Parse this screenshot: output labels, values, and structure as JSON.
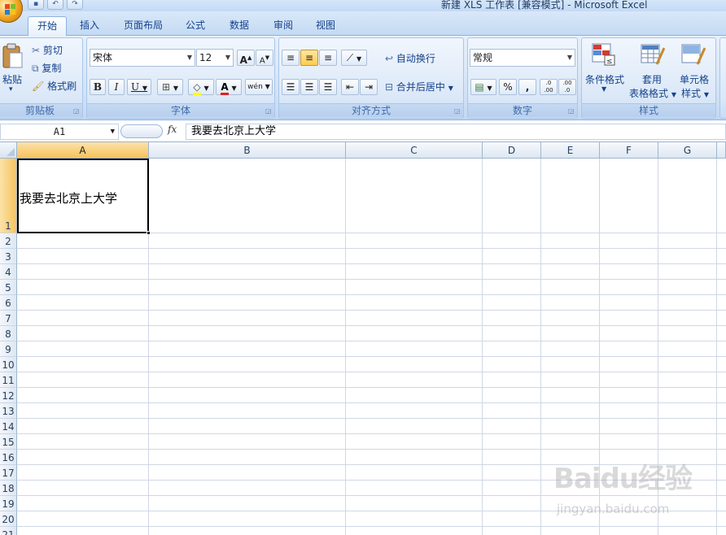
{
  "window": {
    "title": "新建 XLS 工作表 [兼容模式] - Microsoft Excel",
    "qat": [
      "save",
      "undo",
      "redo"
    ]
  },
  "tabs": [
    {
      "label": "开始",
      "active": true
    },
    {
      "label": "插入"
    },
    {
      "label": "页面布局"
    },
    {
      "label": "公式"
    },
    {
      "label": "数据"
    },
    {
      "label": "审阅"
    },
    {
      "label": "视图"
    }
  ],
  "ribbon": {
    "clipboard": {
      "label": "剪贴板",
      "paste": "粘贴",
      "cut": "剪切",
      "copy": "复制",
      "format_painter": "格式刷"
    },
    "font": {
      "label": "字体",
      "font_name": "宋体",
      "font_size": "12",
      "grow": "A",
      "shrink": "A",
      "bold": "B",
      "italic": "I",
      "underline": "U",
      "font_color_letter": "A",
      "phonetic": "wén"
    },
    "alignment": {
      "label": "对齐方式",
      "wrap_text": "自动换行",
      "merge_center": "合并后居中"
    },
    "number": {
      "label": "数字",
      "format": "常规",
      "percent": "%",
      "comma": ",",
      "inc_decimal": ".0 .00",
      "dec_decimal": ".00 .0"
    },
    "styles": {
      "label": "样式",
      "conditional": "条件格式",
      "table_format_1": "套用",
      "table_format_2": "表格格式",
      "cell_styles_1": "单元格",
      "cell_styles_2": "样式"
    }
  },
  "formula_bar": {
    "name_box": "A1",
    "fx": "fx",
    "content": "我要去北京上大学"
  },
  "grid": {
    "columns": [
      "A",
      "B",
      "C",
      "D",
      "E",
      "F",
      "G"
    ],
    "selected_column": "A",
    "rows": [
      "1",
      "2",
      "3",
      "4",
      "5",
      "6",
      "7",
      "8",
      "9",
      "10",
      "11",
      "12",
      "13",
      "14",
      "15",
      "16",
      "17",
      "18",
      "19",
      "20",
      "21"
    ],
    "selected_row": "1",
    "cell_a1": "我要去北京上大学"
  },
  "watermark": {
    "brand": "Baidu经验",
    "url": "jingyan.baidu.com"
  },
  "colors": {
    "ribbon_blue": "#c4daf3",
    "tab_text": "#15428b",
    "selected_header": "#f7c35e",
    "grid_line": "#d0d7e5"
  }
}
